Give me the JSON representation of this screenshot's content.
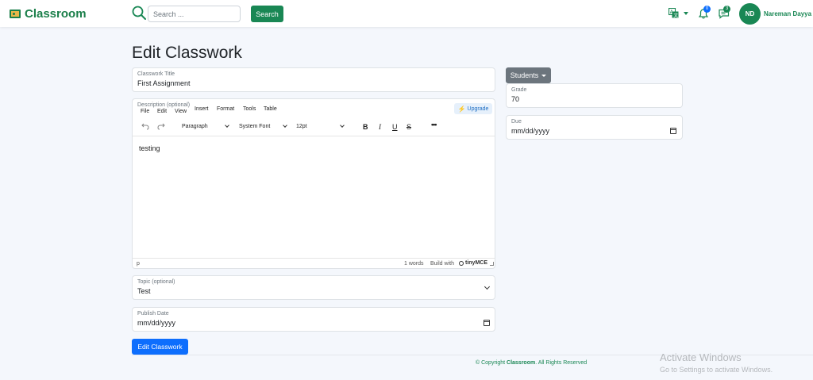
{
  "navbar": {
    "brand": "Classroom",
    "search_placeholder": "Search ...",
    "search_button": "Search",
    "notifications_count": "0",
    "messages_count": "3",
    "user_initials": "ND",
    "user_name": "Nareman Dayya"
  },
  "page": {
    "title": "Edit Classwork"
  },
  "form": {
    "title_label": "Classwork Title",
    "title_value": "First Assignment",
    "description_label": "Description (optional)",
    "topic_label": "Topic (optional)",
    "topic_value": "Test",
    "publish_label": "Publish Date",
    "publish_value": "mm/dd/yyyy",
    "submit_button": "Edit Classwork"
  },
  "editor": {
    "menu": [
      "File",
      "Edit",
      "View",
      "Insert",
      "Format",
      "Tools",
      "Table"
    ],
    "upgrade": "Upgrade",
    "block_format": "Paragraph",
    "font_family": "System Font",
    "font_size": "12pt",
    "content": "testing",
    "status_path": "p",
    "word_count": "1 words",
    "build_with": "Build with",
    "tiny_brand": "tinyMCE"
  },
  "sidebar": {
    "students_button": "Students",
    "grade_label": "Grade",
    "grade_value": "70",
    "due_label": "Due",
    "due_value": "mm/dd/yyyy"
  },
  "footer": {
    "prefix": "© Copyright",
    "brand": "Classroom",
    "suffix": ". All Rights Reserved"
  },
  "watermark": {
    "title": "Activate Windows",
    "subtitle": "Go to Settings to activate Windows."
  },
  "colors": {
    "brand_green": "#198754",
    "primary_blue": "#0d6efd",
    "secondary_gray": "#6c757d"
  }
}
